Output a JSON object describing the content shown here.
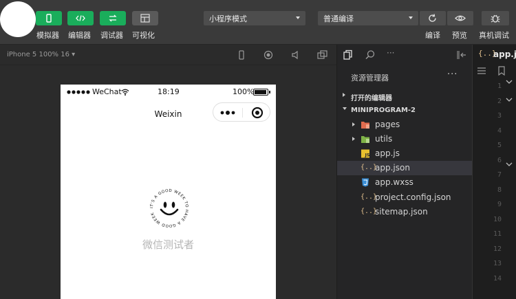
{
  "toolbar": {
    "buttons": [
      {
        "label": "模拟器",
        "icon": "phone-icon"
      },
      {
        "label": "编辑器",
        "icon": "code-icon"
      },
      {
        "label": "调试器",
        "icon": "debug-icon"
      },
      {
        "label": "可视化",
        "icon": "layout-icon"
      }
    ],
    "mode_select": "小程序模式",
    "compile_select": "普通编译",
    "actions": [
      {
        "label": "编译",
        "icon": "refresh-icon"
      },
      {
        "label": "预览",
        "icon": "eye-icon"
      },
      {
        "label": "真机调试",
        "icon": "bug-icon"
      }
    ]
  },
  "simulator": {
    "device_label": "iPhone 5 100% 16 ▾",
    "status": {
      "carrier": "WeChat",
      "time": "18:19",
      "battery": "100%"
    },
    "nav_title": "Weixin",
    "nickname": "微信测试者",
    "logo_ring_text": "IT'S A GOOD WEEK TO HAVE A GOOD WEEK"
  },
  "explorer": {
    "title": "资源管理器",
    "more": "···",
    "open_editors_label": "打开的编辑器",
    "project_label": "MINIPROGRAM-2",
    "files": [
      {
        "name": "pages",
        "type": "folder",
        "icon": "folder-pages-icon"
      },
      {
        "name": "utils",
        "type": "folder",
        "icon": "folder-utils-icon"
      },
      {
        "name": "app.js",
        "type": "js",
        "icon": "js-file-icon"
      },
      {
        "name": "app.json",
        "type": "json",
        "icon": "json-file-icon",
        "selected": true
      },
      {
        "name": "app.wxss",
        "type": "wxss",
        "icon": "css-file-icon"
      },
      {
        "name": "project.config.json",
        "type": "json",
        "icon": "json-file-icon"
      },
      {
        "name": "sitemap.json",
        "type": "json",
        "icon": "json-file-icon"
      }
    ]
  },
  "editor": {
    "tab_name": "app.json",
    "tab_icon": "{..}",
    "line_numbers": [
      "1",
      "2",
      "3",
      "4",
      "5",
      "6",
      "7",
      "8",
      "9",
      "10",
      "11",
      "12",
      "13",
      "14"
    ]
  },
  "colors": {
    "accent_green": "#1aad5b",
    "toolbar_bg": "#3a3a3a",
    "panel_bg": "#252526",
    "editor_bg": "#1e1e1e"
  }
}
